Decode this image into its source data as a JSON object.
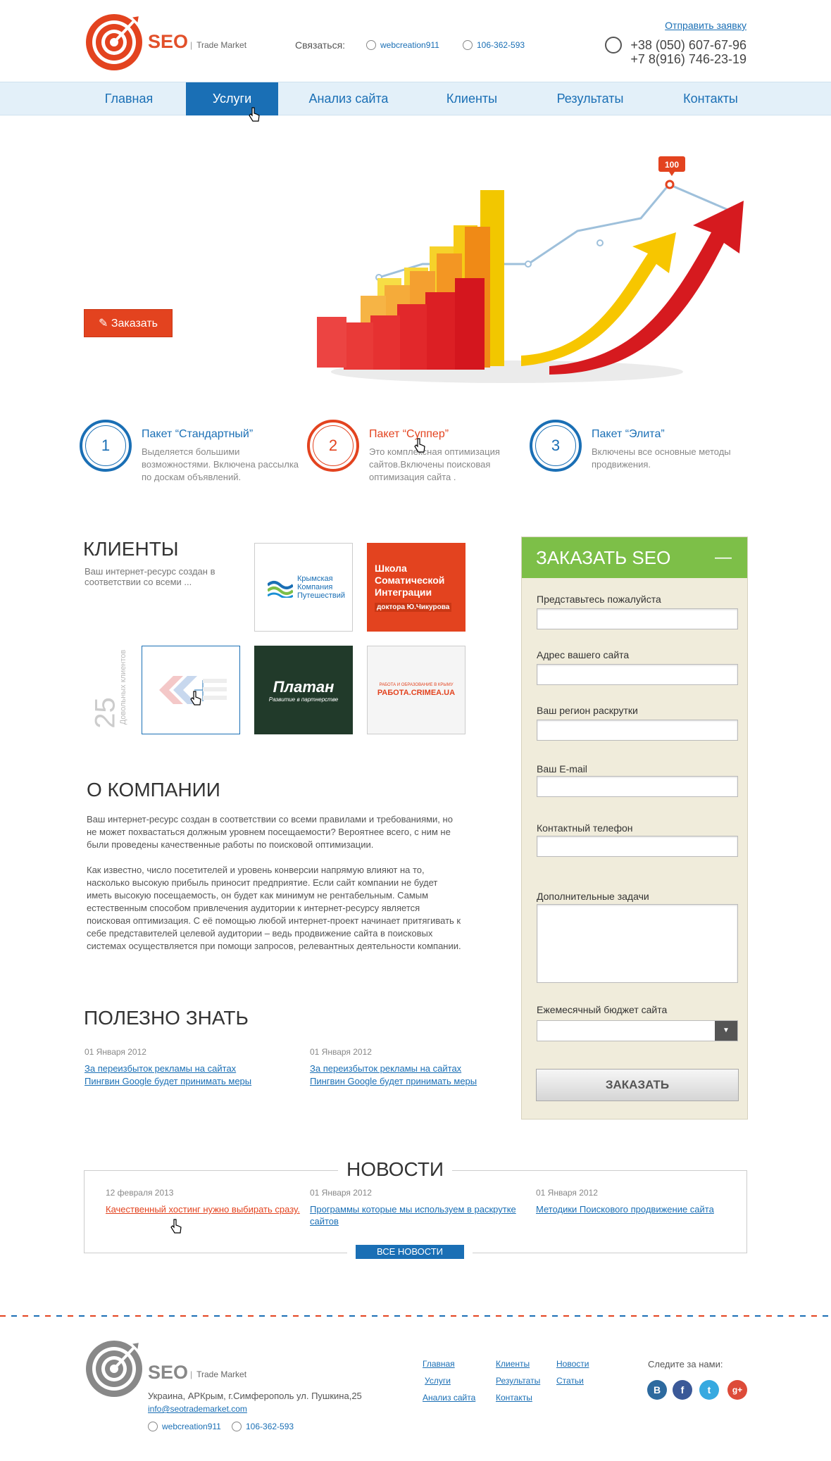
{
  "header": {
    "logo_text": "SEO",
    "logo_sub": "Trade Market",
    "contact_label": "Связаться:",
    "skype": "webcreation911",
    "icq": "106-362-593",
    "send_request": "Отправить заявку",
    "phone1": "+38 (050) 607-67-96",
    "phone2": "+7 8(916) 746-23-19"
  },
  "nav": [
    "Главная",
    "Услуги",
    "Анализ сайта",
    "Клиенты",
    "Результаты",
    "Контакты"
  ],
  "hero": {
    "order_button": "Заказать",
    "chart_badge": "100"
  },
  "packages": [
    {
      "num": "1",
      "title": "Пакет “Стандартный”",
      "desc": "Выделяется большими возможностями. Включена рассылка по доскам объявлений."
    },
    {
      "num": "2",
      "title": "Пакет “Суппер”",
      "desc": "Это комплексная оптимизация сайтов.Включены поисковая оптимизация сайта ."
    },
    {
      "num": "3",
      "title": "Пакет “Элита”",
      "desc": " Включены все основные методы продвижения."
    }
  ],
  "clients": {
    "title": "КЛИЕНТЫ",
    "desc": "Ваш интернет-ресурс создан в соответствии со всеми ...",
    "count": "25",
    "count_label": "Довольных клиентов",
    "logos": [
      "Крымская Компания Путешествий",
      "Школа Соматической Интеграции",
      "доктора Ю.Чикурова",
      "Платан",
      "Развитие в партнерстве",
      "РАБОТА.CRIMEA.UA",
      "РАБОТА И ОБРАЗОВАНИЕ В КРЫМУ"
    ]
  },
  "about": {
    "title": "О КОМПАНИИ",
    "p1": "Ваш интернет-ресурс создан в соответствии со всеми правилами и требованиями, но не может похвастаться должным уровнем посещаемости? Вероятнее всего, с ним не были проведены качественные работы по поисковой оптимизации.",
    "p2": "Как известно, число посетителей и уровень конверсии напрямую влияют на то, насколько высокую прибыль приносит предприятие. Если сайт компании не будет иметь высокую посещаемость, он будет как минимум не рентабельным. Самым естественным способом привлечения аудитории к интернет-ресурсу является поисковая оптимизация. С её помощью любой интернет-проект начинает притягивать к себе представителей целевой аудитории – ведь продвижение сайта в поисковых системах осуществляется при помощи запросов, релевантных деятельности компании."
  },
  "useful": {
    "title": "ПОЛЕЗНО ЗНАТЬ",
    "items": [
      {
        "date": "01 Января  2012",
        "link1": "За переизбыток рекламы на сайтах",
        "link2": "Пингвин Google будет принимать меры"
      },
      {
        "date": "01 Января  2012",
        "link1": "За переизбыток рекламы на сайтах",
        "link2": "Пингвин Google будет принимать меры"
      }
    ]
  },
  "form": {
    "title": "ЗАКАЗАТЬ SEO",
    "collapse": "—",
    "fields": [
      "Представьтесь пожалуйста",
      "Адрес вашего сайта",
      "Ваш регион раскрутки",
      "Ваш E-mail",
      "Контактный телефон",
      "Дополнительные задачи",
      "Ежемесячный бюджет сайта"
    ],
    "submit": "ЗАКАЗАТЬ"
  },
  "news": {
    "title": "НОВОСТИ",
    "items": [
      {
        "date": "12 февраля 2013",
        "link": "Качественный хостинг нужно выбирать сразу."
      },
      {
        "date": "01 Января  2012",
        "link": "Программы которые мы используем в раскрутке сайтов"
      },
      {
        "date": "01 Января  2012",
        "link": "Методики Поискового продвижение сайта"
      }
    ],
    "all_button": "ВСЕ НОВОСТИ"
  },
  "footer": {
    "logo_text": "SEO",
    "logo_sub": "Trade Market",
    "address": "Украина, АРКрым, г.Симферополь ул. Пушкина,25",
    "email": "info@seotrademarket.com",
    "skype": "webcreation911",
    "icq": "106-362-593",
    "links_col1": [
      "Главная",
      "Услуги",
      "Анализ сайта"
    ],
    "links_col2": [
      "Клиенты",
      "Результаты",
      "Контакты"
    ],
    "links_col3": [
      "Новости",
      "Статьи"
    ],
    "follow": "Следите за нами:",
    "social": [
      "В",
      "f",
      "t",
      "g+"
    ]
  },
  "colors": {
    "primary_blue": "#1a6fb5",
    "accent_red": "#e3431f",
    "form_green": "#7dbf48",
    "form_bg": "#f0ecdb"
  }
}
